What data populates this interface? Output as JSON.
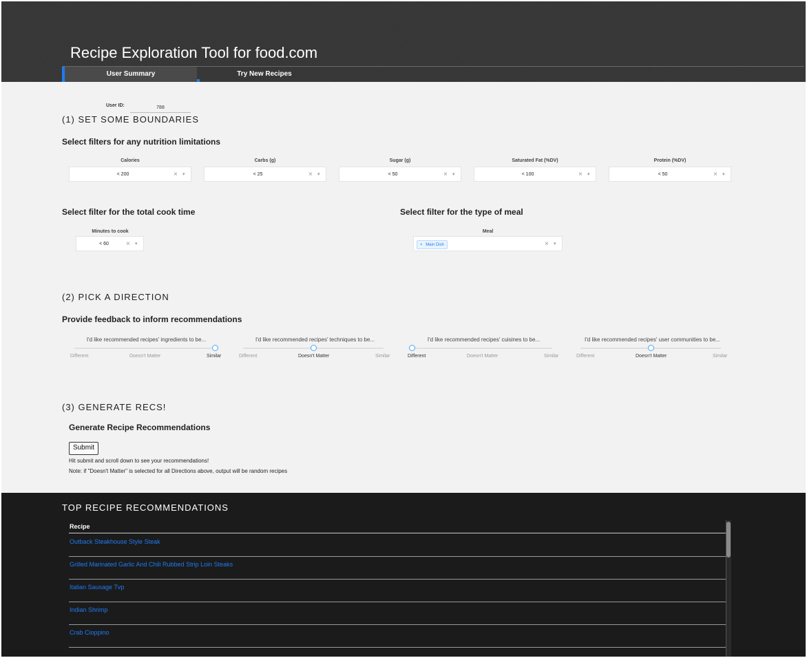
{
  "app": {
    "title": "Recipe Exploration Tool for food.com",
    "tabs": [
      {
        "label": "User Summary",
        "active": true
      },
      {
        "label": "Try New Recipes",
        "active": false
      }
    ],
    "accent_color": "#1e7bf2"
  },
  "user": {
    "label": "User ID:",
    "value": "788"
  },
  "section1": {
    "title": "(1) SET SOME BOUNDARIES",
    "nutrition_heading": "Select filters for any nutrition limitations",
    "filters": [
      {
        "label": "Calories",
        "value": "< 200"
      },
      {
        "label": "Carbs (g)",
        "value": "< 25"
      },
      {
        "label": "Sugar (g)",
        "value": "< 50"
      },
      {
        "label": "Saturated Fat (%DV)",
        "value": "< 100"
      },
      {
        "label": "Protein (%DV)",
        "value": "< 50"
      }
    ],
    "cook_heading": "Select filter for the total cook time",
    "cook_filter": {
      "label": "Minutes to cook",
      "value": "< 60"
    },
    "meal_heading": "Select filter for the type of meal",
    "meal_filter": {
      "label": "Meal",
      "tag": "Main Dish",
      "tag_remove": "×"
    },
    "clear_icon": "×",
    "arrow_icon": "▾"
  },
  "section2": {
    "title": "(2) PICK A DIRECTION",
    "heading": "Provide feedback to inform recommendations",
    "sliders": [
      {
        "title": "I'd like recommended recipes' ingredients to be...",
        "selected": "Similar",
        "position": 1.0
      },
      {
        "title": "I'd like recommended recipes' techniques to be...",
        "selected": "Doesn't Matter",
        "position": 0.5
      },
      {
        "title": "I'd like recommended recipes' cuisines to be...",
        "selected": "Different",
        "position": 0.0
      },
      {
        "title": "I'd like recommended recipes' user communities to be...",
        "selected": "Doesn't Matter",
        "position": 0.5
      }
    ],
    "ticks": [
      "Different",
      "Doesn't Matter",
      "Similar"
    ]
  },
  "section3": {
    "title": "(3) GENERATE RECS!",
    "heading": "Generate Recipe Recommendations",
    "submit_label": "Submit",
    "note1": "Hit submit and scroll down to see your recommendations!",
    "note2": "Note: if \"Doesn't Matter\" is selected for all Directions above, output will be random recipes"
  },
  "results": {
    "title": "TOP RECIPE RECOMMENDATIONS",
    "column_header": "Recipe",
    "recipes": [
      "Outback Steakhouse Style Steak",
      "Grilled Marinated Garlic And Chili Rubbed Strip Loin Steaks",
      "Italian Sausage Tvp",
      "Indian Shrimp",
      "Crab Cioppino"
    ]
  }
}
